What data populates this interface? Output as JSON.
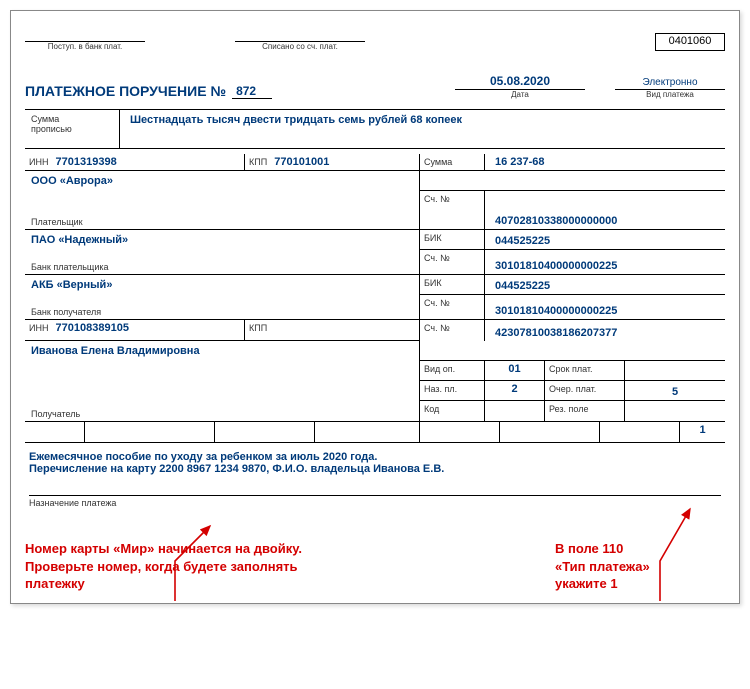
{
  "header": {
    "form_code": "0401060",
    "postup_label": "Поступ. в банк плат.",
    "spisano_label": "Списано со сч. плат."
  },
  "title": {
    "main": "ПЛАТЕЖНОЕ ПОРУЧЕНИЕ №",
    "number": "872",
    "date": "05.08.2020",
    "date_label": "Дата",
    "vid_label": "Вид платежа",
    "vid_value": "Электронно"
  },
  "summa_propis": {
    "label1": "Сумма",
    "label2": "прописью",
    "value": "Шестнадцать тысяч двести тридцать семь рублей 68 копеек"
  },
  "payer": {
    "inn_label": "ИНН",
    "inn": "7701319398",
    "kpp_label": "КПП",
    "kpp": "770101001",
    "summa_label": "Сумма",
    "summa": "16 237-68",
    "name": "ООО «Аврора»",
    "sch_label": "Сч. №",
    "sch": "40702810338000000000",
    "platelshik_label": "Плательщик"
  },
  "payer_bank": {
    "name": "ПАО «Надежный»",
    "bik_label": "БИК",
    "bik": "044525225",
    "sch_label": "Сч. №",
    "sch": "30101810400000000225",
    "bank_label": "Банк плательщика"
  },
  "recip_bank": {
    "name": "АКБ «Верный»",
    "bik_label": "БИК",
    "bik": "044525225",
    "sch_label": "Сч. №",
    "sch": "30101810400000000225",
    "bank_label": "Банк получателя"
  },
  "recipient": {
    "inn_label": "ИНН",
    "inn": "770108389105",
    "kpp_label": "КПП",
    "kpp": "",
    "sch_label": "Сч. №",
    "sch": "42307810038186207377",
    "name": "Иванова Елена Владимировна"
  },
  "footer_grid": {
    "vid_op_label": "Вид оп.",
    "vid_op": "01",
    "srok_label": "Срок плат.",
    "naz_pl_label": "Наз. пл.",
    "naz_pl": "2",
    "ocher_label": "Очер. плат.",
    "ocher": "5",
    "kod_label": "Код",
    "rez_label": "Рез. поле",
    "poluchatel_label": "Получатель"
  },
  "field_110": "1",
  "purpose": {
    "line1": "Ежемесячное пособие по уходу за ребенком за июль 2020 года.",
    "line2": "Перечисление на карту 2200 8967 1234 9870,  Ф.И.О. владельца Иванова Е.В.",
    "label": "Назначение платежа"
  },
  "notes": {
    "left1": "Номер карты «Мир» начинается на двойку.",
    "left2": "Проверьте номер, когда будете заполнять",
    "left3": "платежку",
    "right1": "В поле 110",
    "right2": "«Тип платежа»",
    "right3": "укажите 1"
  }
}
